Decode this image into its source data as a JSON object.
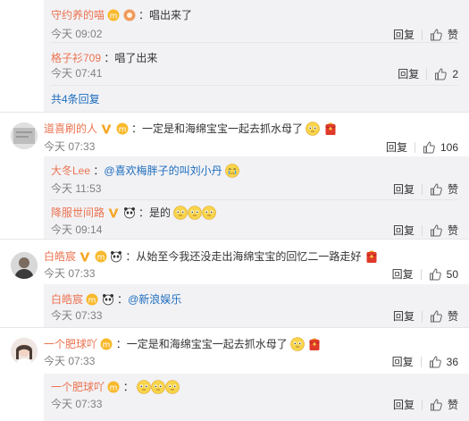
{
  "common": {
    "reply_label": "回复",
    "more_replies": "共4条回复"
  },
  "c1": {
    "name": "守约养的喵",
    "text": "：唱出来了",
    "time": "今天 09:02",
    "likes": "赞"
  },
  "c2": {
    "name": "格子衫709",
    "text": "：唱了出来",
    "time": "今天 07:41",
    "likes": "2"
  },
  "c3": {
    "name": "道喜刷的人",
    "text": "：一定是和海绵宝宝一起去抓水母了",
    "time": "今天 07:33",
    "likes": "106"
  },
  "c4": {
    "name": "大冬Lee",
    "text_pre": "：",
    "mention": "@喜欢梅胖子的叫刘小丹",
    "time": "今天 11:53",
    "likes": "赞"
  },
  "c5": {
    "name": "降服世间路",
    "text": "：是的",
    "time": "今天 09:14",
    "likes": "赞"
  },
  "c6": {
    "name": "白皓宸",
    "text": "：从始至今我还没走出海绵宝宝的回忆二一路走好",
    "time": "今天 07:33",
    "likes": "50"
  },
  "c7": {
    "name": "白皓宸",
    "text_pre": "：",
    "mention": "@新浪娱乐",
    "time": "今天 07:33",
    "likes": "赞"
  },
  "c8": {
    "name": "一个肥球吖",
    "text": "：一定是和海绵宝宝一起去抓水母了",
    "time": "今天 07:33",
    "likes": "36"
  },
  "c9": {
    "name": "一个肥球吖",
    "text": "：",
    "time": "今天 07:33",
    "likes": "赞"
  }
}
